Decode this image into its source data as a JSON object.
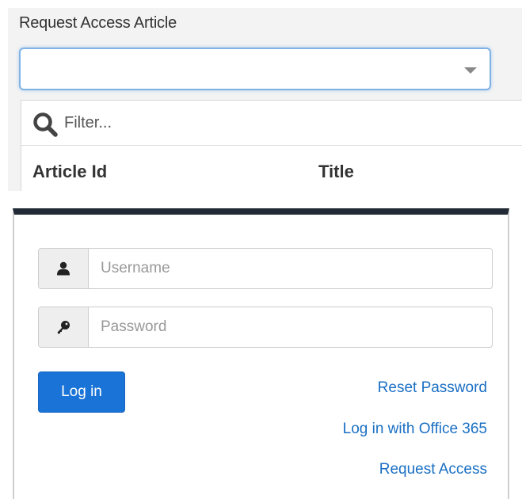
{
  "request_article": {
    "label": "Request Access Article",
    "selected_value": "",
    "filter": {
      "placeholder": "Filter..."
    },
    "columns": [
      "Article Id",
      "Title"
    ]
  },
  "login": {
    "username_placeholder": "Username",
    "password_placeholder": "Password",
    "login_button": "Log in",
    "links": {
      "reset_password": "Reset Password",
      "office365": "Log in with Office 365",
      "request_access": "Request Access"
    }
  },
  "icons": {
    "filter": "search-icon",
    "username": "user-icon",
    "password": "key-icon",
    "select": "chevron-down-icon"
  },
  "colors": {
    "primary_button": "#1a73d6",
    "link": "#1a6fc4",
    "panel_top_border": "#222b35",
    "select_focus_border": "#7fb3e6"
  }
}
